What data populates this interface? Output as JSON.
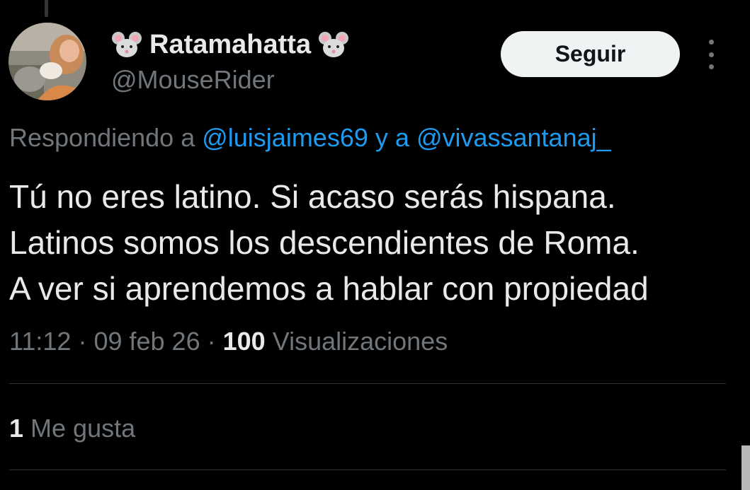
{
  "author": {
    "display_name": "Ratamahatta",
    "handle": "@MouseRider",
    "avatar_icon": "profile-photo",
    "name_emoji": "mouse-face-emoji"
  },
  "follow_button": {
    "label": "Seguir"
  },
  "more_menu": {
    "icon": "more-vertical-icon"
  },
  "reply_context": {
    "prefix": "Respondiendo a",
    "mention_1": "@luisjaimes69",
    "connector": "y a",
    "mention_2": "@vivassantanaj_"
  },
  "tweet": {
    "lines": [
      "Tú no eres latino. Si acaso serás hispana.",
      "Latinos somos los descendientes de Roma.",
      "A ver si aprendemos a hablar con propiedad"
    ]
  },
  "meta": {
    "time": "11:12",
    "separator": "·",
    "date": "09 feb 26",
    "views_count": "100",
    "views_label": "Visualizaciones"
  },
  "likes": {
    "count": "1",
    "label": "Me gusta"
  },
  "colors": {
    "background": "#000000",
    "text": "#e7e9ea",
    "secondary": "#71767b",
    "link": "#1d9bf0",
    "button_bg": "#eff3f4"
  }
}
